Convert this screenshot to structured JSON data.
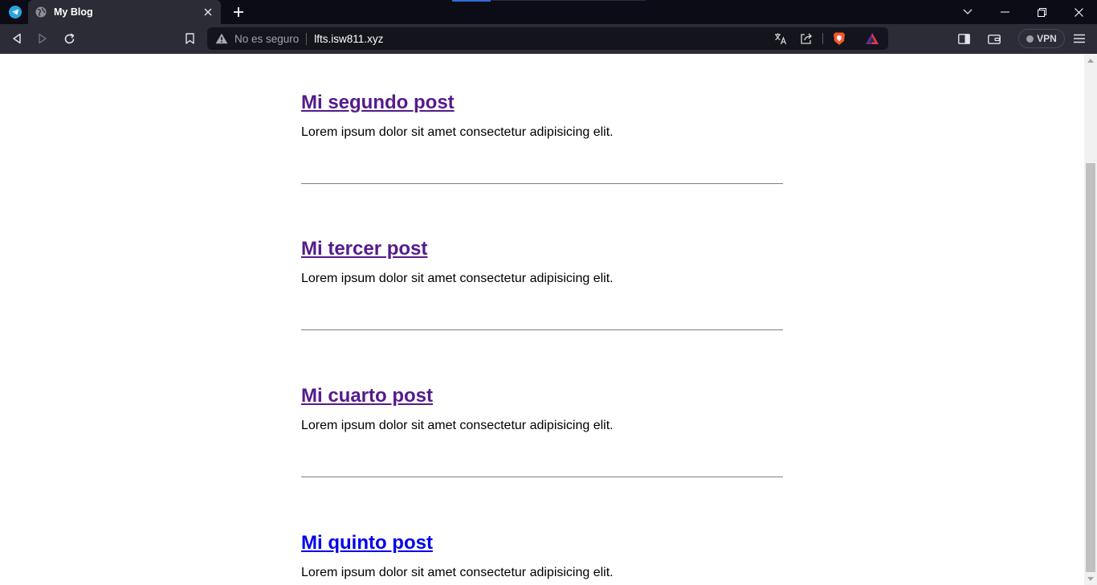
{
  "browser": {
    "tab_title": "My Blog",
    "security_label": "No es seguro",
    "url": "lfts.isw811.xyz",
    "vpn_label": "VPN"
  },
  "posts": [
    {
      "title": "Mi segundo post",
      "excerpt": "Lorem ipsum dolor sit amet consectetur adipisicing elit.",
      "visited": true
    },
    {
      "title": "Mi tercer post",
      "excerpt": "Lorem ipsum dolor sit amet consectetur adipisicing elit.",
      "visited": true
    },
    {
      "title": "Mi cuarto post",
      "excerpt": "Lorem ipsum dolor sit amet consectetur adipisicing elit.",
      "visited": true
    },
    {
      "title": "Mi quinto post",
      "excerpt": "Lorem ipsum dolor sit amet consectetur adipisicing elit.",
      "visited": false
    }
  ],
  "icons": {
    "pinned_tab": "telegram-icon",
    "tab_favicon": "globe-icon",
    "address_warning": "warning-icon",
    "shield": "brave-shield-icon",
    "rewards": "brave-rewards-icon"
  },
  "colors": {
    "visited_link": "#551a8b",
    "unvisited_link": "#0000ee",
    "shield": "#fb542b",
    "browser_chrome": "#2b2c36",
    "tab_strip": "#0b0c16"
  }
}
